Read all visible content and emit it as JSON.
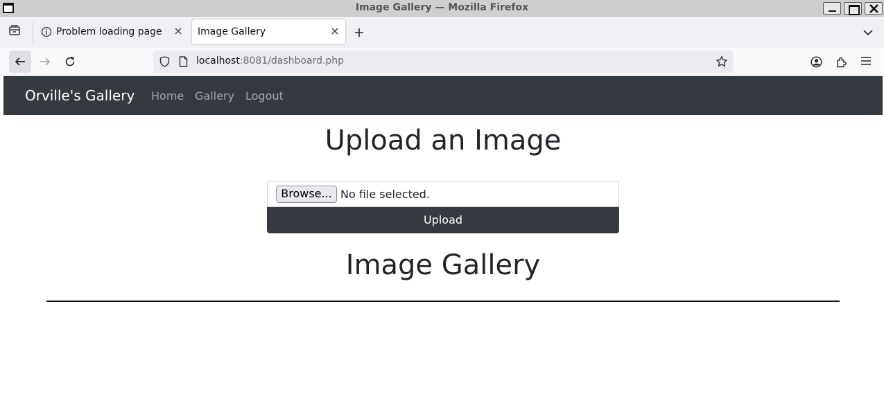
{
  "window": {
    "title": "Image Gallery — Mozilla Firefox"
  },
  "tabs": [
    {
      "label": "Problem loading page",
      "icon": "info-icon",
      "active": false
    },
    {
      "label": "Image Gallery",
      "icon": "",
      "active": true
    }
  ],
  "urlbar": {
    "host": "localhost",
    "rest": ":8081/dashboard.php"
  },
  "site": {
    "brand": "Orville's Gallery",
    "nav": {
      "home": "Home",
      "gallery": "Gallery",
      "logout": "Logout"
    },
    "upload_heading": "Upload an Image",
    "file_input": {
      "button_label": "Browse...",
      "status": "No file selected."
    },
    "upload_button": "Upload",
    "gallery_heading": "Image Gallery"
  },
  "colors": {
    "navbar_bg": "#343a40",
    "page_bg": "#ffffff",
    "heading_text": "#212529"
  }
}
